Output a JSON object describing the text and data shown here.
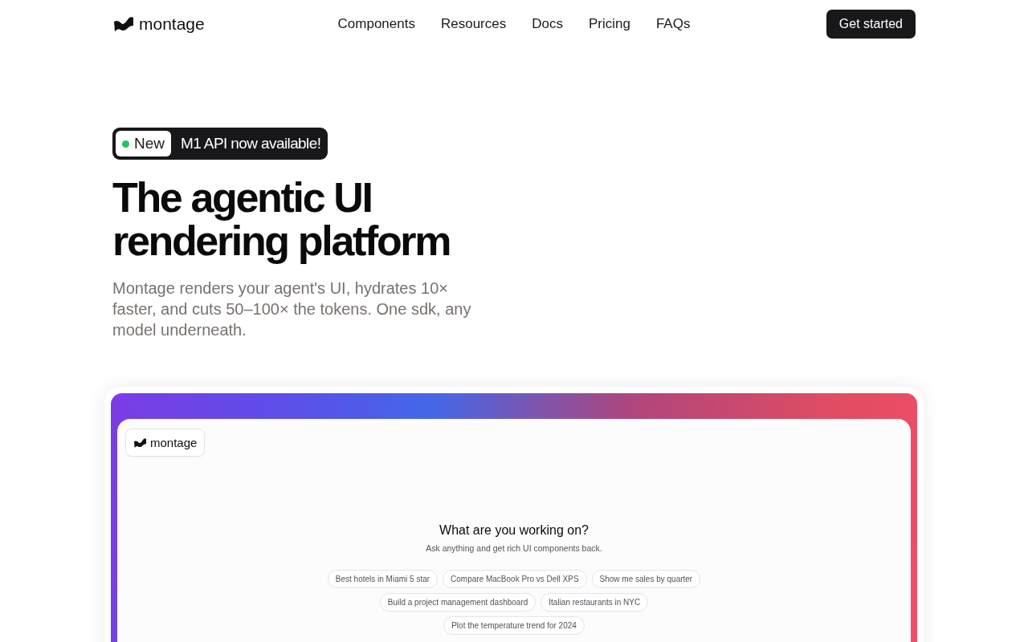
{
  "nav": {
    "logo": "montage",
    "links": [
      "Components",
      "Resources",
      "Docs",
      "Pricing",
      "FAQs"
    ],
    "cta": "Get started"
  },
  "hero": {
    "badge": {
      "tag": "New",
      "text": "M1 API now available!"
    },
    "title": "The agentic UI rendering platform",
    "description": "Montage renders your agent's UI, hydrates 10× faster, and cuts 50–100× the tokens. One sdk, any model underneath."
  },
  "preview": {
    "logo": "montage",
    "heading": "What are you working on?",
    "subheading": "Ask anything and get rich UI components back.",
    "suggestions": [
      "Best hotels in Miami 5 star",
      "Compare MacBook Pro vs Dell XPS",
      "Show me sales by quarter",
      "Build a project management dashboard",
      "Italian restaurants in NYC",
      "Plot the temperature trend for 2024"
    ]
  }
}
